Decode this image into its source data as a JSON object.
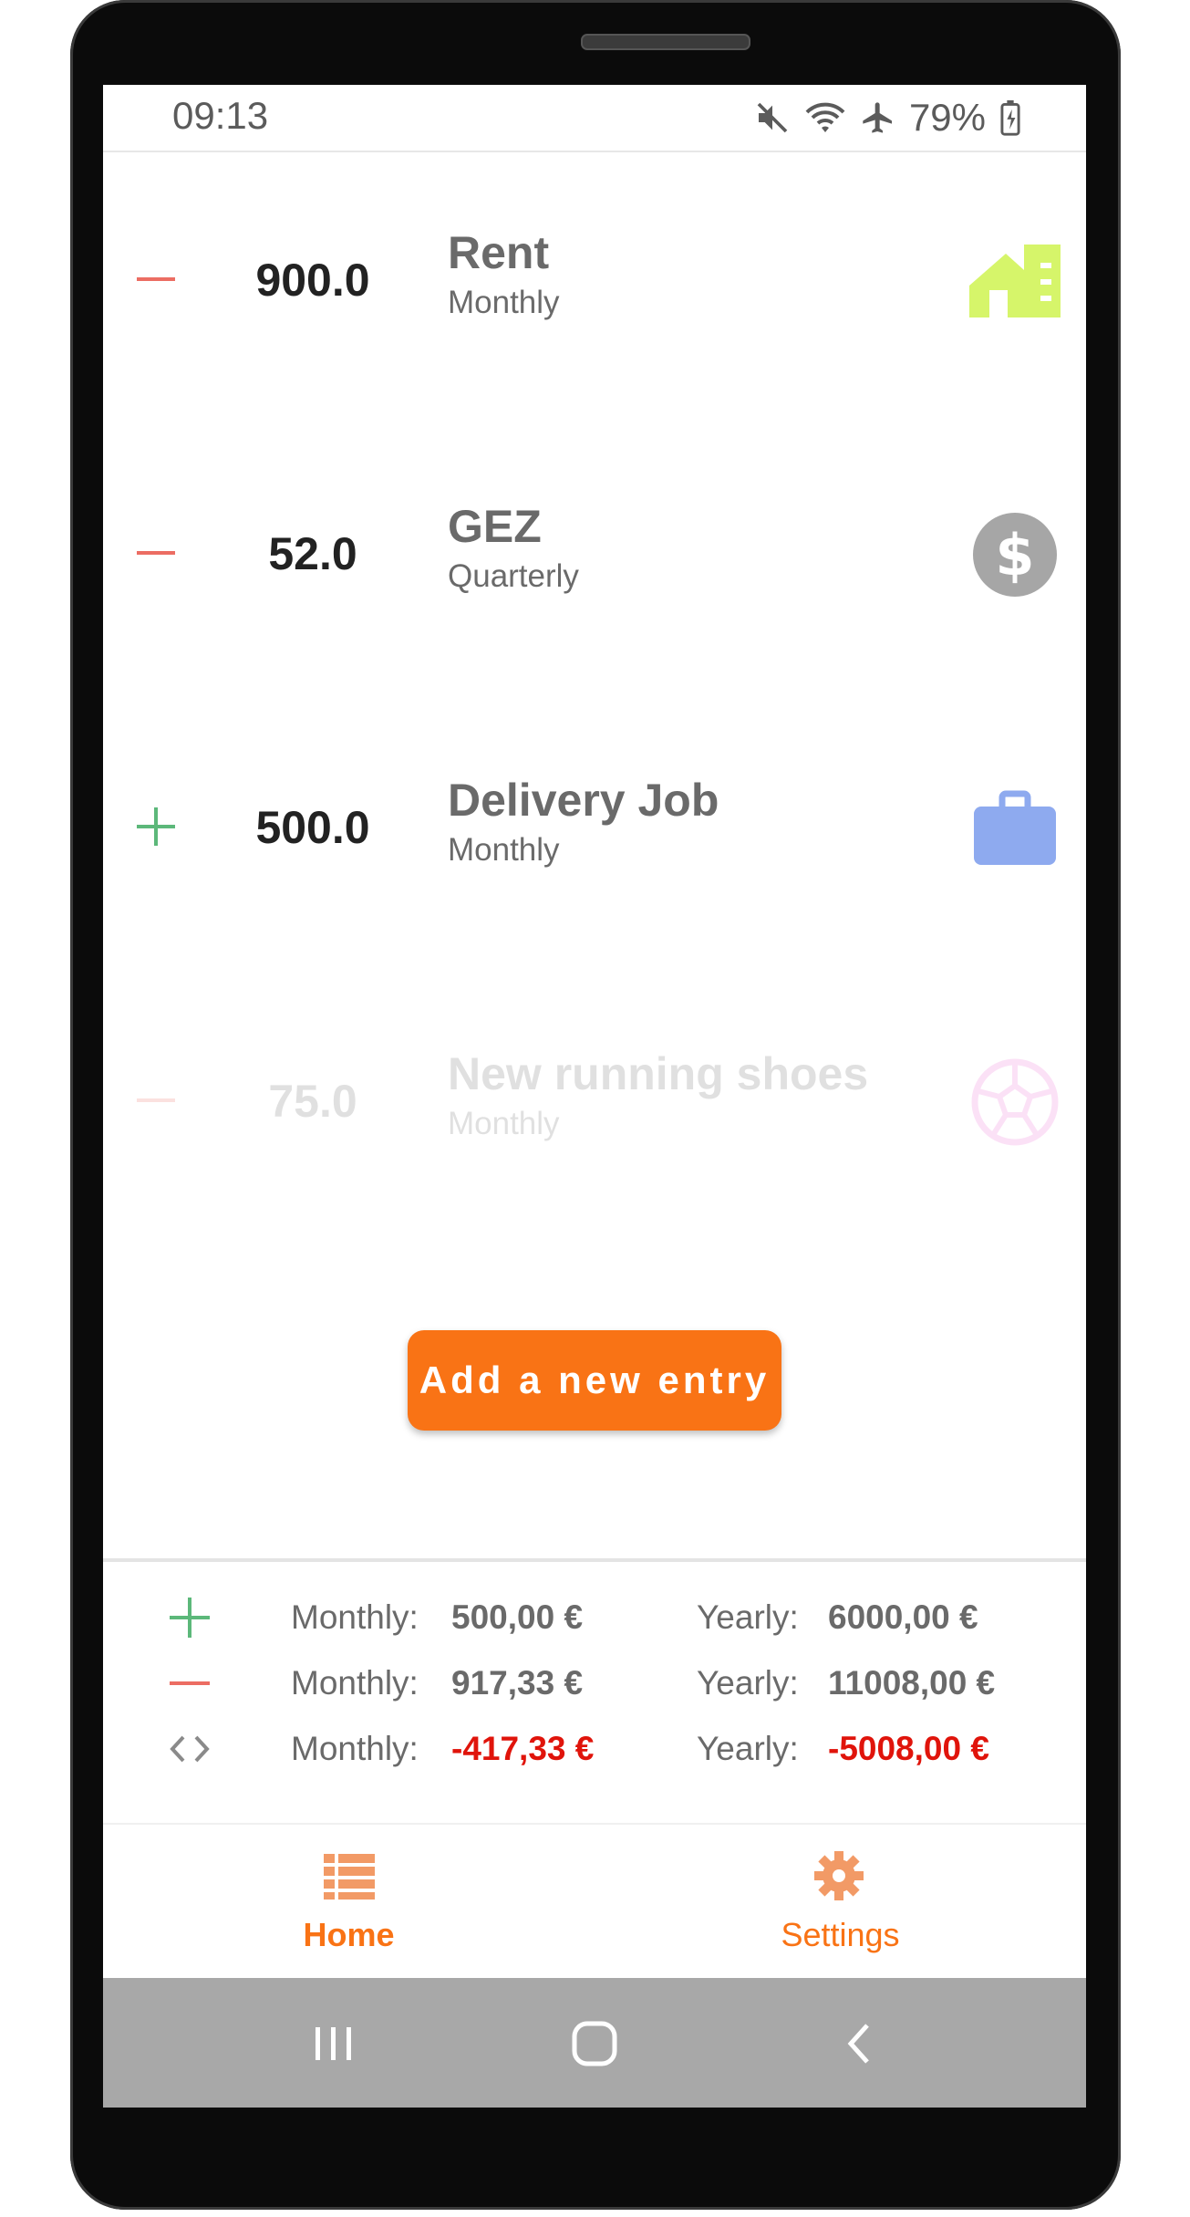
{
  "status": {
    "time": "09:13",
    "battery": "79%"
  },
  "entries": [
    {
      "sign": "minus",
      "amount": "900.0",
      "title": "Rent",
      "frequency": "Monthly",
      "icon": "house-icon",
      "color": "#d6f56a"
    },
    {
      "sign": "minus",
      "amount": "52.0",
      "title": "GEZ",
      "frequency": "Quarterly",
      "icon": "dollar-icon",
      "color": "#a6a6a6"
    },
    {
      "sign": "plus",
      "amount": "500.0",
      "title": "Delivery Job",
      "frequency": "Monthly",
      "icon": "briefcase-icon",
      "color": "#8eaaef"
    },
    {
      "sign": "minus",
      "amount": "75.0",
      "title": "New running shoes",
      "frequency": "Monthly",
      "icon": "ball-icon",
      "color": "#f06fd6"
    }
  ],
  "add_button": "Add a new entry",
  "summary": {
    "income": {
      "monthly_label": "Monthly:",
      "monthly_value": "500,00 €",
      "yearly_label": "Yearly:",
      "yearly_value": "6000,00 €"
    },
    "expenses": {
      "monthly_label": "Monthly:",
      "monthly_value": "917,33 €",
      "yearly_label": "Yearly:",
      "yearly_value": "11008,00 €"
    },
    "balance": {
      "monthly_label": "Monthly:",
      "monthly_value": "-417,33 €",
      "yearly_label": "Yearly:",
      "yearly_value": "-5008,00 €"
    }
  },
  "nav": {
    "home_label": "Home",
    "settings_label": "Settings"
  },
  "colors": {
    "accent": "#f97315",
    "income": "#5cb87a",
    "expense": "#ec6d63",
    "negative": "#e0140b"
  }
}
